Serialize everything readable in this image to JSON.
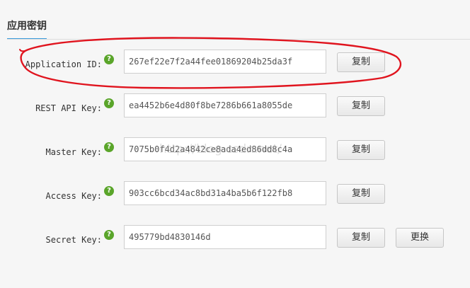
{
  "section": {
    "title": "应用密钥"
  },
  "keys": [
    {
      "label": "Application ID:",
      "value": "267ef22e7f2a44fee01869204b25da3f",
      "copy_label": "复制"
    },
    {
      "label": "REST API Key:",
      "value": "ea4452b6e4d80f8be7286b661a8055de",
      "copy_label": "复制"
    },
    {
      "label": "Master Key:",
      "value": "7075b0f4d2a4842ce8ada4ed86dd8c4a",
      "copy_label": "复制"
    },
    {
      "label": "Access Key:",
      "value": "903cc6bcd34ac8bd31a4ba5b6f122fb8",
      "copy_label": "复制"
    },
    {
      "label": "Secret Key:",
      "value": "495779bd4830146d",
      "copy_label": "复制",
      "replace_label": "更换"
    }
  ],
  "help_icon_glyph": "?",
  "watermark": "http://blog.csdn.net/",
  "colors": {
    "accent": "#3a9bdc",
    "help_icon": "#5aa52a",
    "annotation": "#e0141e"
  }
}
